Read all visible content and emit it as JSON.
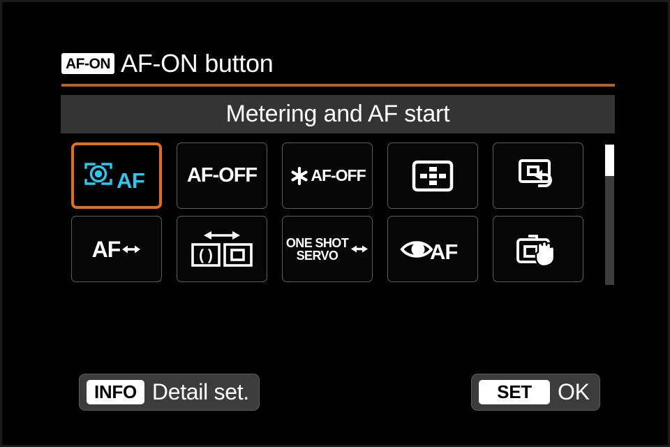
{
  "screen": {
    "background_color": "#000000",
    "accent_color": "#e0701c",
    "rule_color": "#b5622a",
    "highlight_color": "#2bc8f0"
  },
  "header": {
    "badge": "AF-ON",
    "title": "AF-ON button"
  },
  "subtitle": {
    "text": "Metering and AF start"
  },
  "grid": {
    "selected_index": 0,
    "options": [
      {
        "name": "metering-and-af-start",
        "label": "AF",
        "icon": "metering-af-icon",
        "selected": true
      },
      {
        "name": "af-off",
        "label": "AF-OFF",
        "icon": "text-only",
        "selected": false
      },
      {
        "name": "ae-lock-af-off",
        "label": "AF-OFF",
        "icon": "ae-lock-asterisk-icon",
        "selected": false
      },
      {
        "name": "af-point-selection",
        "label": "",
        "icon": "af-point-selection-icon",
        "selected": false
      },
      {
        "name": "switch-to-registered-af-point",
        "label": "",
        "icon": "registered-af-point-icon",
        "selected": false
      },
      {
        "name": "direct-af-method-selection",
        "label": "AF",
        "icon": "af-arrows-icon",
        "selected": false
      },
      {
        "name": "switch-af-area",
        "label": "",
        "icon": "switch-af-area-icon",
        "selected": false
      },
      {
        "name": "one-shot-servo-switch",
        "label": "ONE SHOT\nSERVO",
        "icon": "one-shot-servo-icon",
        "selected": false
      },
      {
        "name": "eye-detection-af",
        "label": "AF",
        "icon": "eye-af-icon",
        "selected": false
      },
      {
        "name": "touch-and-drag-af",
        "label": "",
        "icon": "touch-drag-af-icon",
        "selected": false
      }
    ]
  },
  "scrollbar": {
    "position": "top",
    "thumb_fraction": "0.22"
  },
  "footer": {
    "info_badge": "INFO",
    "info_label": "Detail set.",
    "set_badge": "SET",
    "set_label": "OK"
  }
}
